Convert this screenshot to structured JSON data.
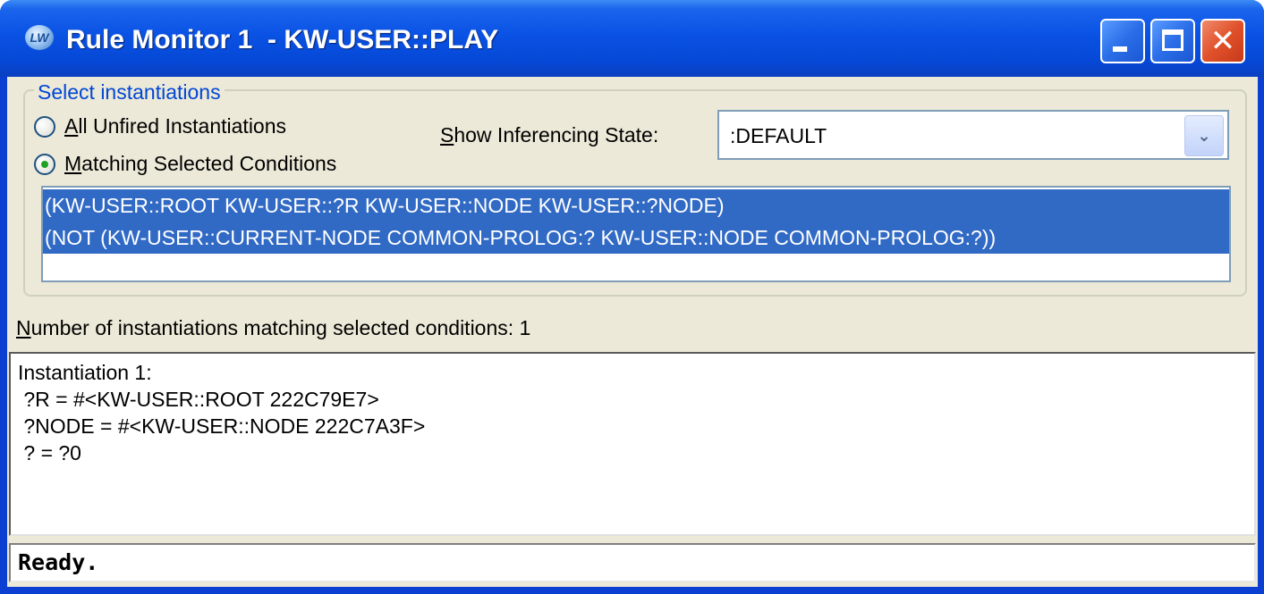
{
  "window": {
    "title": "Rule Monitor 1  - KW-USER::PLAY",
    "app_icon_text": "LW",
    "controls": {
      "minimize": "minimize",
      "maximize": "maximize",
      "close": "✕"
    }
  },
  "select_group": {
    "legend": "Select instantiations",
    "radio_all": {
      "underlined": "A",
      "rest": "ll Unfired Instantiations",
      "checked": false
    },
    "radio_matching": {
      "underlined": "M",
      "rest": "atching Selected Conditions",
      "checked": true
    },
    "inferencing_label_underlined": "S",
    "inferencing_label_rest": "how Inferencing State:",
    "inferencing_value": ":DEFAULT",
    "conditions": [
      "(KW-USER::ROOT KW-USER::?R KW-USER::NODE KW-USER::?NODE)",
      "(NOT (KW-USER::CURRENT-NODE COMMON-PROLOG:? KW-USER::NODE COMMON-PROLOG:?))"
    ]
  },
  "count": {
    "underlined": "N",
    "rest": "umber of instantiations matching selected conditions: 1"
  },
  "output_lines": [
    "Instantiation 1:",
    " ?R = #<KW-USER::ROOT 222C79E7>",
    " ?NODE = #<KW-USER::NODE 222C7A3F>",
    " ? = ?0"
  ],
  "status": "Ready.",
  "colors": {
    "title_blue": "#0a52e4",
    "selection": "#316ac5",
    "legend_text": "#0046d5",
    "dialog_bg": "#ece9d8",
    "close_red": "#e0512a"
  },
  "icons": [
    "app-icon",
    "minimize-icon",
    "maximize-icon",
    "close-icon",
    "dropdown-arrow-icon"
  ]
}
